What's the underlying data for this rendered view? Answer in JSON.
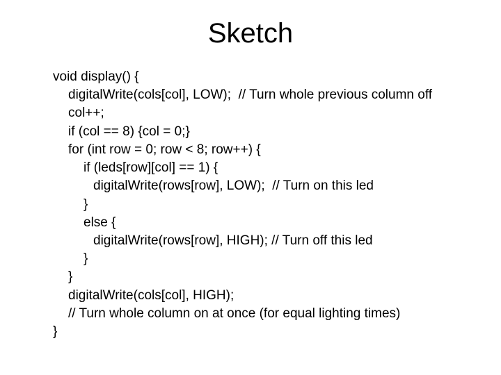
{
  "title": "Sketch",
  "code": {
    "l0": "void display() {",
    "l1": "digitalWrite(cols[col], LOW);  // Turn whole previous column off",
    "l2": "col++;",
    "l3": "if (col == 8) {col = 0;}",
    "l4": "for (int row = 0; row < 8; row++) {",
    "l5": "if (leds[row][col] == 1) {",
    "l6": "digitalWrite(rows[row], LOW);  // Turn on this led",
    "l7": "}",
    "l8": "else {",
    "l9": "digitalWrite(rows[row], HIGH); // Turn off this led",
    "l10": "}",
    "l11": "}",
    "l12": "digitalWrite(cols[col], HIGH);",
    "l13": "// Turn whole column on at once (for equal lighting times)",
    "l14": "}"
  }
}
